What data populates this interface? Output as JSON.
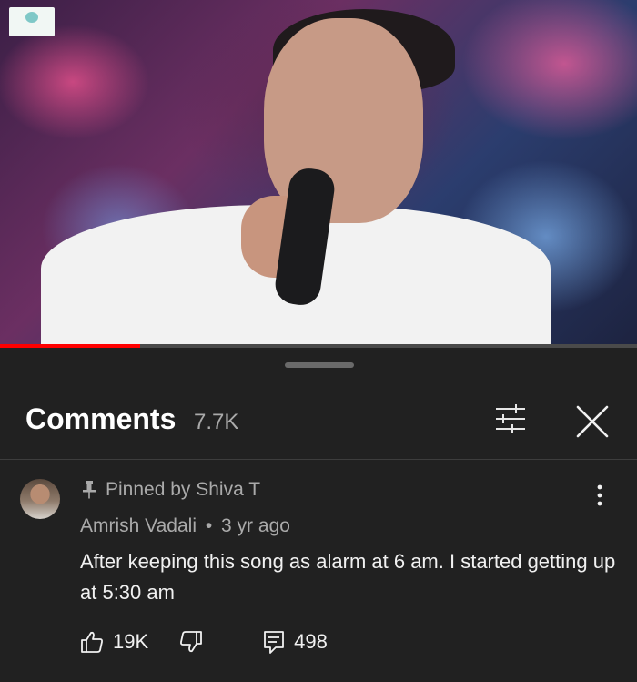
{
  "video": {
    "logo_icon": "channel-watermark-icon",
    "progress_fraction": 0.22,
    "progress_color": "#ff0000"
  },
  "comments_panel": {
    "title": "Comments",
    "count": "7.7K",
    "filter_icon": "sliders-icon",
    "close_icon": "close-icon"
  },
  "pinned_comment": {
    "pin_icon": "pin-icon",
    "pinned_label": "Pinned by Shiva T",
    "author": "Amrish Vadali",
    "separator": "•",
    "time": "3 yr ago",
    "text": "After keeping this song as alarm at 6 am. I started getting up at 5:30 am",
    "likes": "19K",
    "replies": "498",
    "like_icon": "thumbs-up-icon",
    "dislike_icon": "thumbs-down-icon",
    "reply_icon": "reply-icon",
    "more_icon": "more-vertical-icon"
  }
}
